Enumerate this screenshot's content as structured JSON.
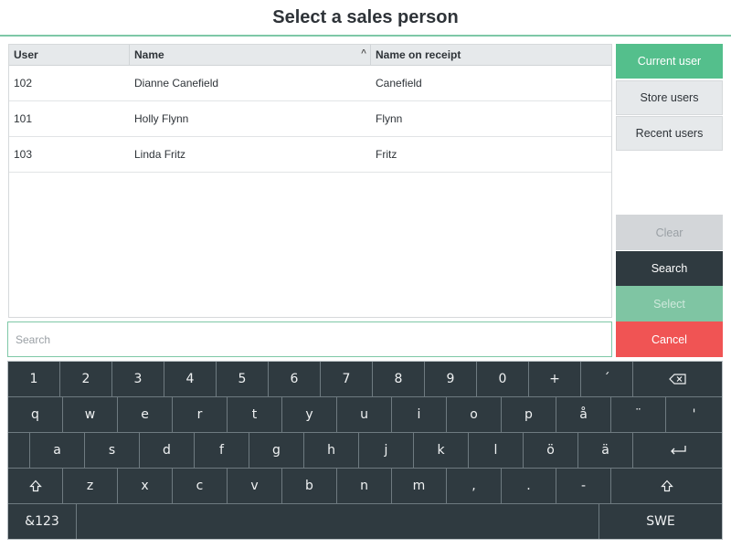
{
  "header": {
    "title": "Select a sales person"
  },
  "table": {
    "columns": [
      "User",
      "Name",
      "Name on receipt"
    ],
    "sort_icon": "^",
    "rows": [
      {
        "user": "102",
        "name": "Dianne Canefield",
        "receipt": "Canefield"
      },
      {
        "user": "101",
        "name": "Holly Flynn",
        "receipt": "Flynn"
      },
      {
        "user": "103",
        "name": "Linda Fritz",
        "receipt": "Fritz"
      }
    ]
  },
  "side_buttons": {
    "current_user": "Current user",
    "store_users": "Store users",
    "recent_users": "Recent users",
    "clear": "Clear",
    "search": "Search",
    "select": "Select",
    "cancel": "Cancel"
  },
  "search": {
    "placeholder": "Search",
    "value": ""
  },
  "keyboard": {
    "row1": [
      "1",
      "2",
      "3",
      "4",
      "5",
      "6",
      "7",
      "8",
      "9",
      "0",
      "+",
      "´"
    ],
    "row2": [
      "q",
      "w",
      "e",
      "r",
      "t",
      "y",
      "u",
      "i",
      "o",
      "p",
      "å",
      "¨",
      "'"
    ],
    "row3": [
      "a",
      "s",
      "d",
      "f",
      "g",
      "h",
      "j",
      "k",
      "l",
      "ö",
      "ä"
    ],
    "row4": [
      "z",
      "x",
      "c",
      "v",
      "b",
      "n",
      "m",
      ",",
      ".",
      "-"
    ],
    "symbols_key": "&123",
    "language_key": "SWE",
    "icons": {
      "backspace": "backspace-icon",
      "enter": "enter-icon",
      "shift": "shift-icon"
    }
  },
  "colors": {
    "accent_green": "#54bf8c",
    "dark": "#2f3a40",
    "cancel_red": "#f05454"
  }
}
